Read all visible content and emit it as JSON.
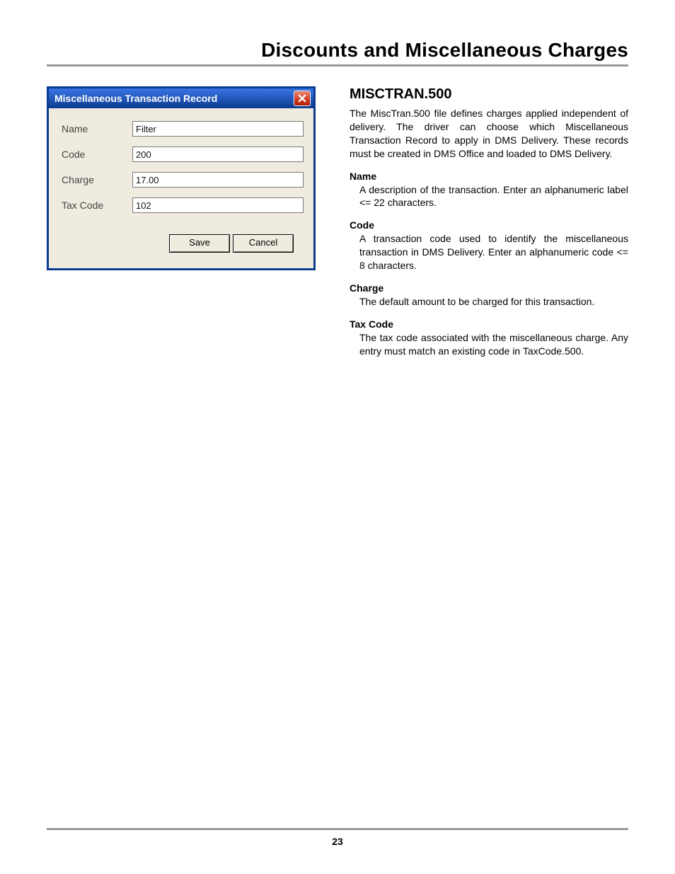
{
  "page": {
    "header": "Discounts and Miscellaneous Charges",
    "number": "23"
  },
  "dialog": {
    "title": "Miscellaneous Transaction Record",
    "labels": {
      "name": "Name",
      "code": "Code",
      "charge": "Charge",
      "taxcode": "Tax Code"
    },
    "values": {
      "name": "Filter",
      "code": "200",
      "charge": "17.00",
      "taxcode": "102"
    },
    "buttons": {
      "save": "Save",
      "cancel": "Cancel"
    }
  },
  "doc": {
    "section_title": "MISCTRAN.500",
    "intro": "The MiscTran.500 file defines charges applied independent of delivery. The driver can choose which Miscellaneous Transaction Record to apply in DMS Delivery. These records must be created in DMS Office and loaded to DMS Delivery.",
    "fields": {
      "name": {
        "head": "Name",
        "desc": "A description of the transaction. Enter an alphanumeric label <= 22 characters."
      },
      "code": {
        "head": "Code",
        "desc": "A transaction code used to identify the miscellaneous transaction in DMS Delivery. Enter an alphanumeric code <= 8 characters."
      },
      "charge": {
        "head": "Charge",
        "desc": "The default amount to be charged for this transaction."
      },
      "taxcode": {
        "head": "Tax Code",
        "desc": "The tax code associated with the miscellaneous charge. Any entry must match an existing code in TaxCode.500."
      }
    }
  }
}
